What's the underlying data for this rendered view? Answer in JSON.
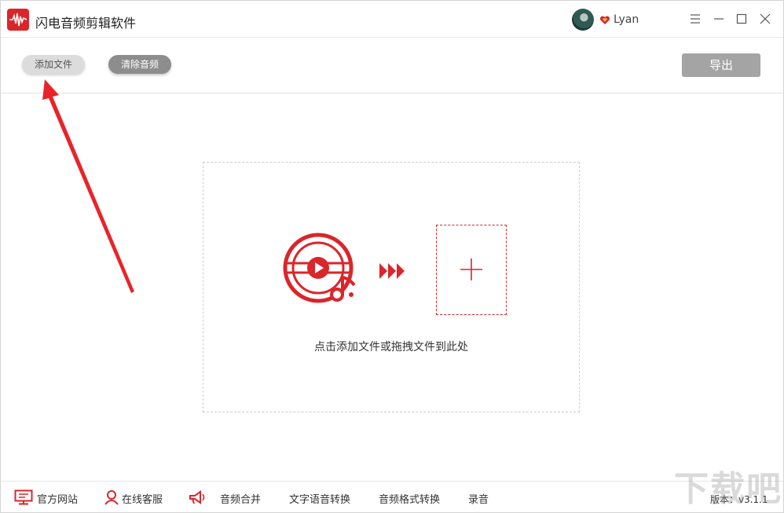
{
  "app": {
    "title": "闪电音频剪辑软件",
    "user": "Lyan"
  },
  "toolbar": {
    "add_file_label": "添加文件",
    "clear_audio_label": "清除音频",
    "export_label": "导出"
  },
  "dropzone": {
    "hint": "点击添加文件或拖拽文件到此处"
  },
  "footer": {
    "official_site": "官方网站",
    "online_support": "在线客服",
    "audio_merge": "音频合并",
    "text_to_speech": "文字语音转换",
    "format_convert": "音频格式转换",
    "record": "录音",
    "version": "版本：v3.1.1"
  },
  "watermark": "下载吧",
  "colors": {
    "brand_red": "#d9262b",
    "export_gray": "#a4a4a4"
  },
  "icons": [
    "app-logo-icon",
    "avatar",
    "heart-vip-icon",
    "menu-icon",
    "minimize-icon",
    "maximize-icon",
    "close-icon",
    "music-disc-icon",
    "triple-arrow-icon",
    "plus-icon",
    "monitor-icon",
    "user-support-icon",
    "megaphone-icon"
  ]
}
